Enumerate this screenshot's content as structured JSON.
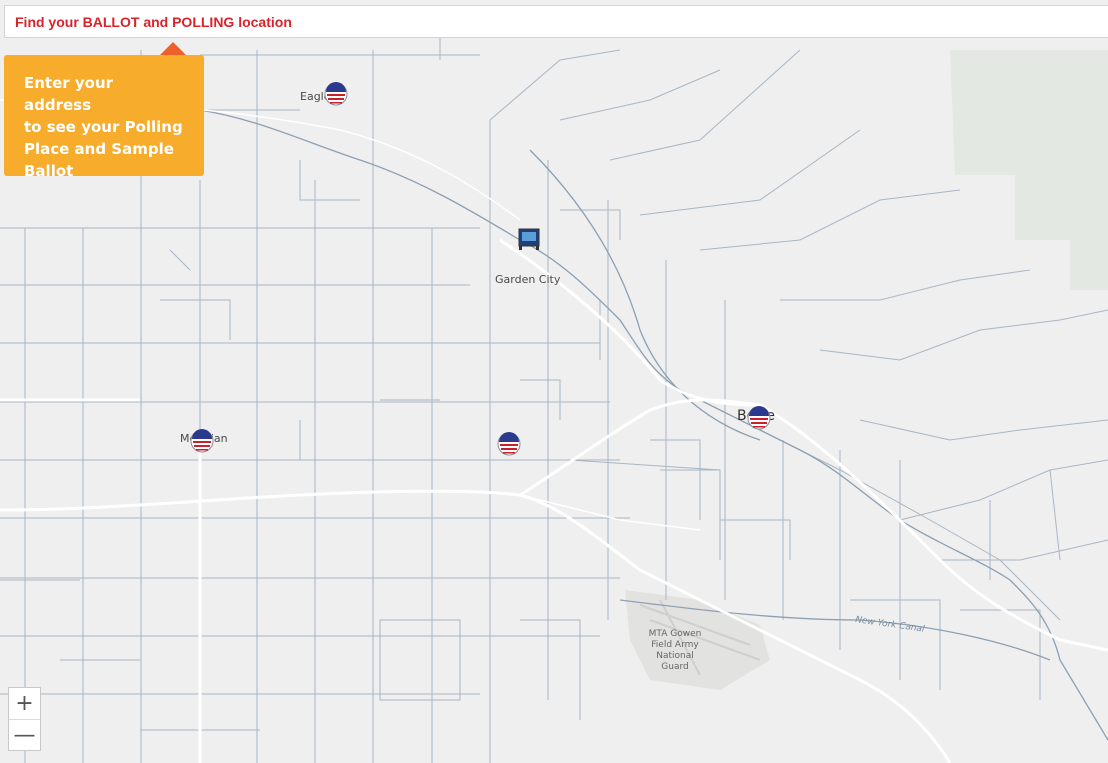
{
  "search": {
    "placeholder": "Find your BALLOT and POLLING location"
  },
  "tooltip": {
    "line1": "Enter your address",
    "line2": "to see your Polling",
    "line3": "Place and Sample",
    "line4": "Ballot"
  },
  "zoom": {
    "in_label": "+",
    "out_label": "—"
  },
  "map": {
    "places": {
      "eagle": "Eagle",
      "garden_city": "Garden City",
      "meridian": "Meridian",
      "boise": "Boise",
      "airport_line1": "MTA Gowen",
      "airport_line2": "Field Army",
      "airport_line3": "National",
      "airport_line4": "Guard",
      "canal": "New York Canal"
    },
    "colors": {
      "background": "#efefef",
      "street": "#9aa9b8",
      "highway": "#ffffff",
      "accent_red": "#d8232a",
      "tooltip": "#f7ac2c",
      "arrow": "#f0602a"
    },
    "markers": [
      "polling-marker-icon",
      "polling-marker-icon",
      "polling-marker-icon",
      "polling-marker-icon",
      "ballot-dropbox-icon"
    ]
  }
}
